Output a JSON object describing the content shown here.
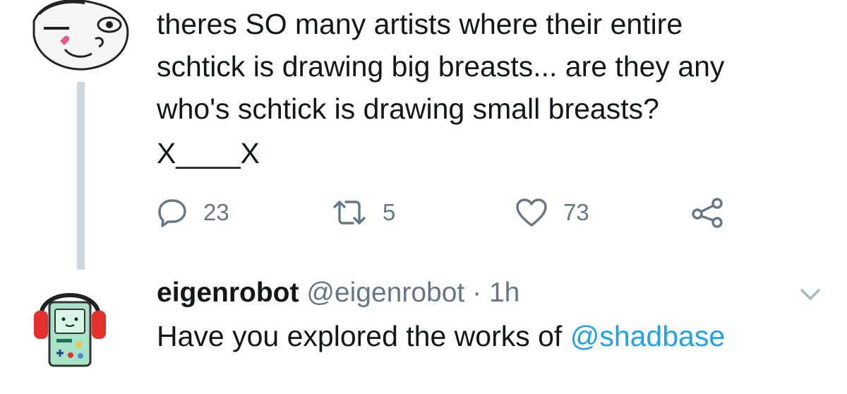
{
  "thread": {
    "tweet": {
      "text": "theres SO many artists where their entire\nschtick is drawing big breasts... are they any\nwho's schtick is drawing small breasts?",
      "signoff": "X____X",
      "actions": {
        "replies": "23",
        "retweets": "5",
        "likes": "73"
      }
    },
    "reply": {
      "display_name": "eigenrobot",
      "handle": "@eigenrobot",
      "separator": "·",
      "time": "1h",
      "text_prefix": "Have you explored the works of ",
      "mention": "@shadbase"
    }
  },
  "icons": {
    "reply": "reply-icon",
    "retweet": "retweet-icon",
    "like": "heart-icon",
    "share": "share-icon",
    "more": "chevron-down-icon"
  },
  "colors": {
    "text": "#14171a",
    "secondary": "#657786",
    "link": "#1da1f2",
    "thread_line": "#ccd6dd"
  }
}
